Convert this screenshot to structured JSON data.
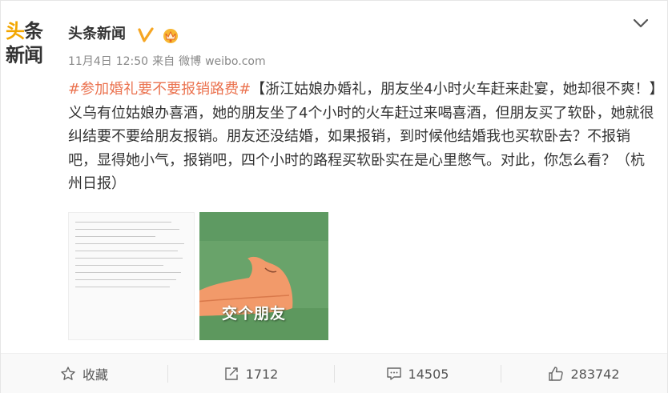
{
  "author": {
    "logo_line1_part1": "头",
    "logo_line1_part2": "条",
    "logo_line2": "新闻",
    "name": "头条新闻"
  },
  "meta": {
    "date": "11月4日",
    "time": "12:50",
    "source_prefix": "来自",
    "source_app": "微博",
    "source_site": "weibo.com"
  },
  "post": {
    "hashtag": "#参加婚礼要不要报销路费#",
    "body": "【浙江姑娘办婚礼，朋友坐4小时火车赶来赴宴，她却很不爽！】义乌有位姑娘办喜酒，她的朋友坐了4个小时的火车赶过来喝喜酒，但朋友买了软卧，她就很纠结要不要给朋友报销。朋友还没结婚，如果报销，到时候他结婚我也买软卧去？不报销吧，显得她小气，报销吧，四个小时的路程买软卧实在是心里憋气。对此，你怎么看？（杭州日报）"
  },
  "images": {
    "meme_caption": "交个朋友"
  },
  "actions": {
    "favorite": "收藏",
    "repost": "1712",
    "comment": "14505",
    "like": "283742"
  },
  "colors": {
    "hashtag": "#eb7350",
    "logo_accent": "#f2a600",
    "verified": "#f6a623"
  }
}
